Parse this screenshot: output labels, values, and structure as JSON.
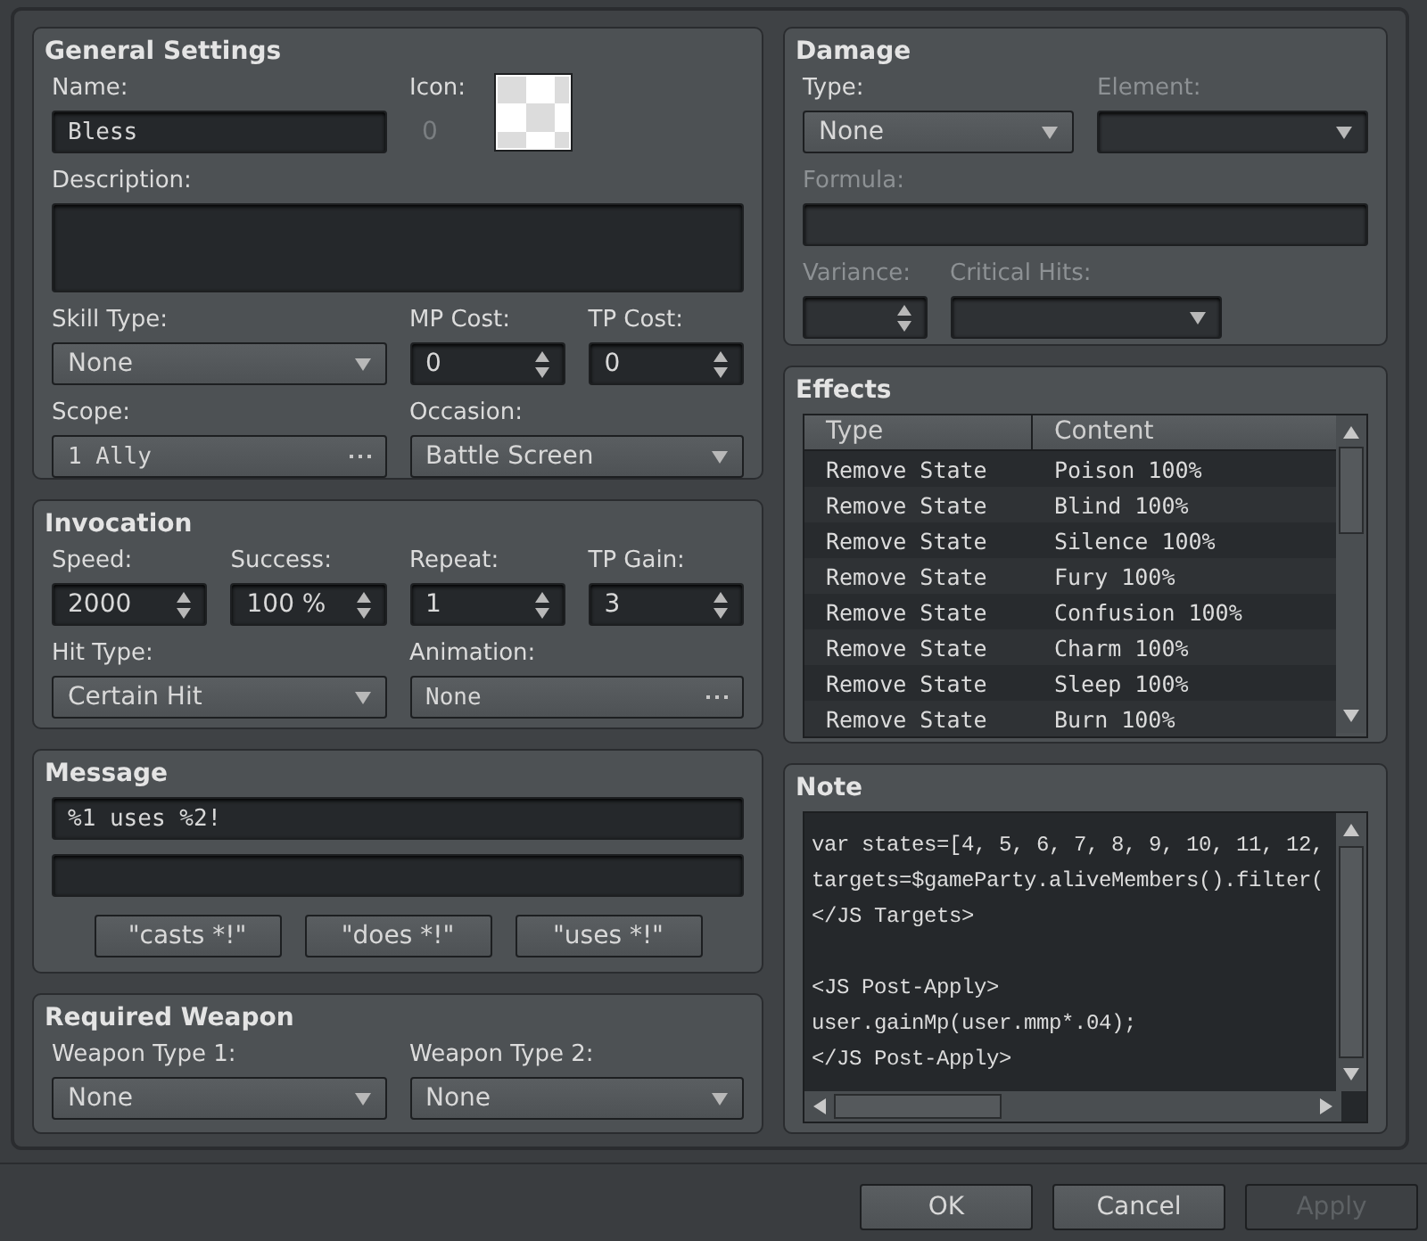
{
  "general": {
    "title": "General Settings",
    "rows": [
      {
        "fields": [
          {
            "kind": "text",
            "label": "Name:",
            "value": "Bless"
          },
          {
            "kind": "icon",
            "label": "Icon:",
            "value": "0"
          }
        ]
      },
      {
        "fields": [
          {
            "kind": "textarea",
            "label": "Description:"
          }
        ]
      },
      {
        "fields": [
          {
            "kind": "select",
            "label": "Skill Type:",
            "value": "None"
          },
          {
            "kind": "spin",
            "label": "MP Cost:",
            "value": "0"
          },
          {
            "kind": "spin",
            "label": "TP Cost:",
            "value": "0"
          }
        ]
      },
      {
        "fields": [
          {
            "kind": "picker",
            "label": "Scope:",
            "value": "1 Ally"
          },
          {
            "kind": "select",
            "label": "Occasion:",
            "value": "Battle Screen"
          }
        ]
      }
    ]
  },
  "invocation": {
    "title": "Invocation",
    "rows": [
      {
        "fields": [
          {
            "kind": "spin",
            "label": "Speed:",
            "value": "2000"
          },
          {
            "kind": "spin",
            "label": "Success:",
            "value": "100 %"
          },
          {
            "kind": "spin",
            "label": "Repeat:",
            "value": "1"
          },
          {
            "kind": "spin",
            "label": "TP Gain:",
            "value": "3"
          }
        ]
      },
      {
        "fields": [
          {
            "kind": "select",
            "label": "Hit Type:",
            "value": "Certain Hit"
          },
          {
            "kind": "picker",
            "label": "Animation:",
            "value": "None"
          }
        ]
      }
    ]
  },
  "message": {
    "title": "Message",
    "rows": [
      {
        "fields": [
          {
            "kind": "text",
            "value": "%1 uses %2!"
          }
        ]
      },
      {
        "fields": [
          {
            "kind": "text"
          }
        ]
      }
    ],
    "buttons": [
      "\"casts *!\"",
      "\"does *!\"",
      "\"uses *!\""
    ]
  },
  "required_weapon": {
    "title": "Required Weapon",
    "rows": [
      {
        "fields": [
          {
            "kind": "select",
            "label": "Weapon Type 1:",
            "value": "None"
          },
          {
            "kind": "select",
            "label": "Weapon Type 2:",
            "value": "None"
          }
        ]
      }
    ]
  },
  "damage": {
    "title": "Damage",
    "rows": [
      {
        "fields": [
          {
            "kind": "select",
            "label": "Type:",
            "value": "None",
            "disabled": false
          },
          {
            "kind": "select",
            "label": "Element:",
            "disabled": true
          }
        ]
      },
      {
        "fields": [
          {
            "kind": "text",
            "label": "Formula:",
            "disabled": true
          }
        ]
      },
      {
        "fields": [
          {
            "kind": "spin",
            "label": "Variance:",
            "disabled": true
          },
          {
            "kind": "select",
            "label": "Critical Hits:",
            "disabled": true
          }
        ]
      }
    ]
  },
  "effects": {
    "title": "Effects",
    "columns": [
      "Type",
      "Content"
    ],
    "rows": [
      [
        "Remove State",
        "Poison 100%"
      ],
      [
        "Remove State",
        "Blind 100%"
      ],
      [
        "Remove State",
        "Silence 100%"
      ],
      [
        "Remove State",
        "Fury 100%"
      ],
      [
        "Remove State",
        "Confusion 100%"
      ],
      [
        "Remove State",
        "Charm 100%"
      ],
      [
        "Remove State",
        "Sleep 100%"
      ],
      [
        "Remove State",
        "Burn 100%"
      ]
    ]
  },
  "note": {
    "title": "Note",
    "blocks": [
      [
        "var states=[4, 5, 6, 7, 8, 9, 10, 11, 12,",
        "targets=$gameParty.aliveMembers().filter(",
        "</JS Targets>"
      ],
      [
        "<JS Post-Apply>",
        "user.gainMp(user.mmp*.04);",
        "</JS Post-Apply>"
      ]
    ]
  },
  "buttons": [
    {
      "label": "OK",
      "disabled": false
    },
    {
      "label": "Cancel",
      "disabled": false
    },
    {
      "label": "Apply",
      "disabled": true
    }
  ]
}
